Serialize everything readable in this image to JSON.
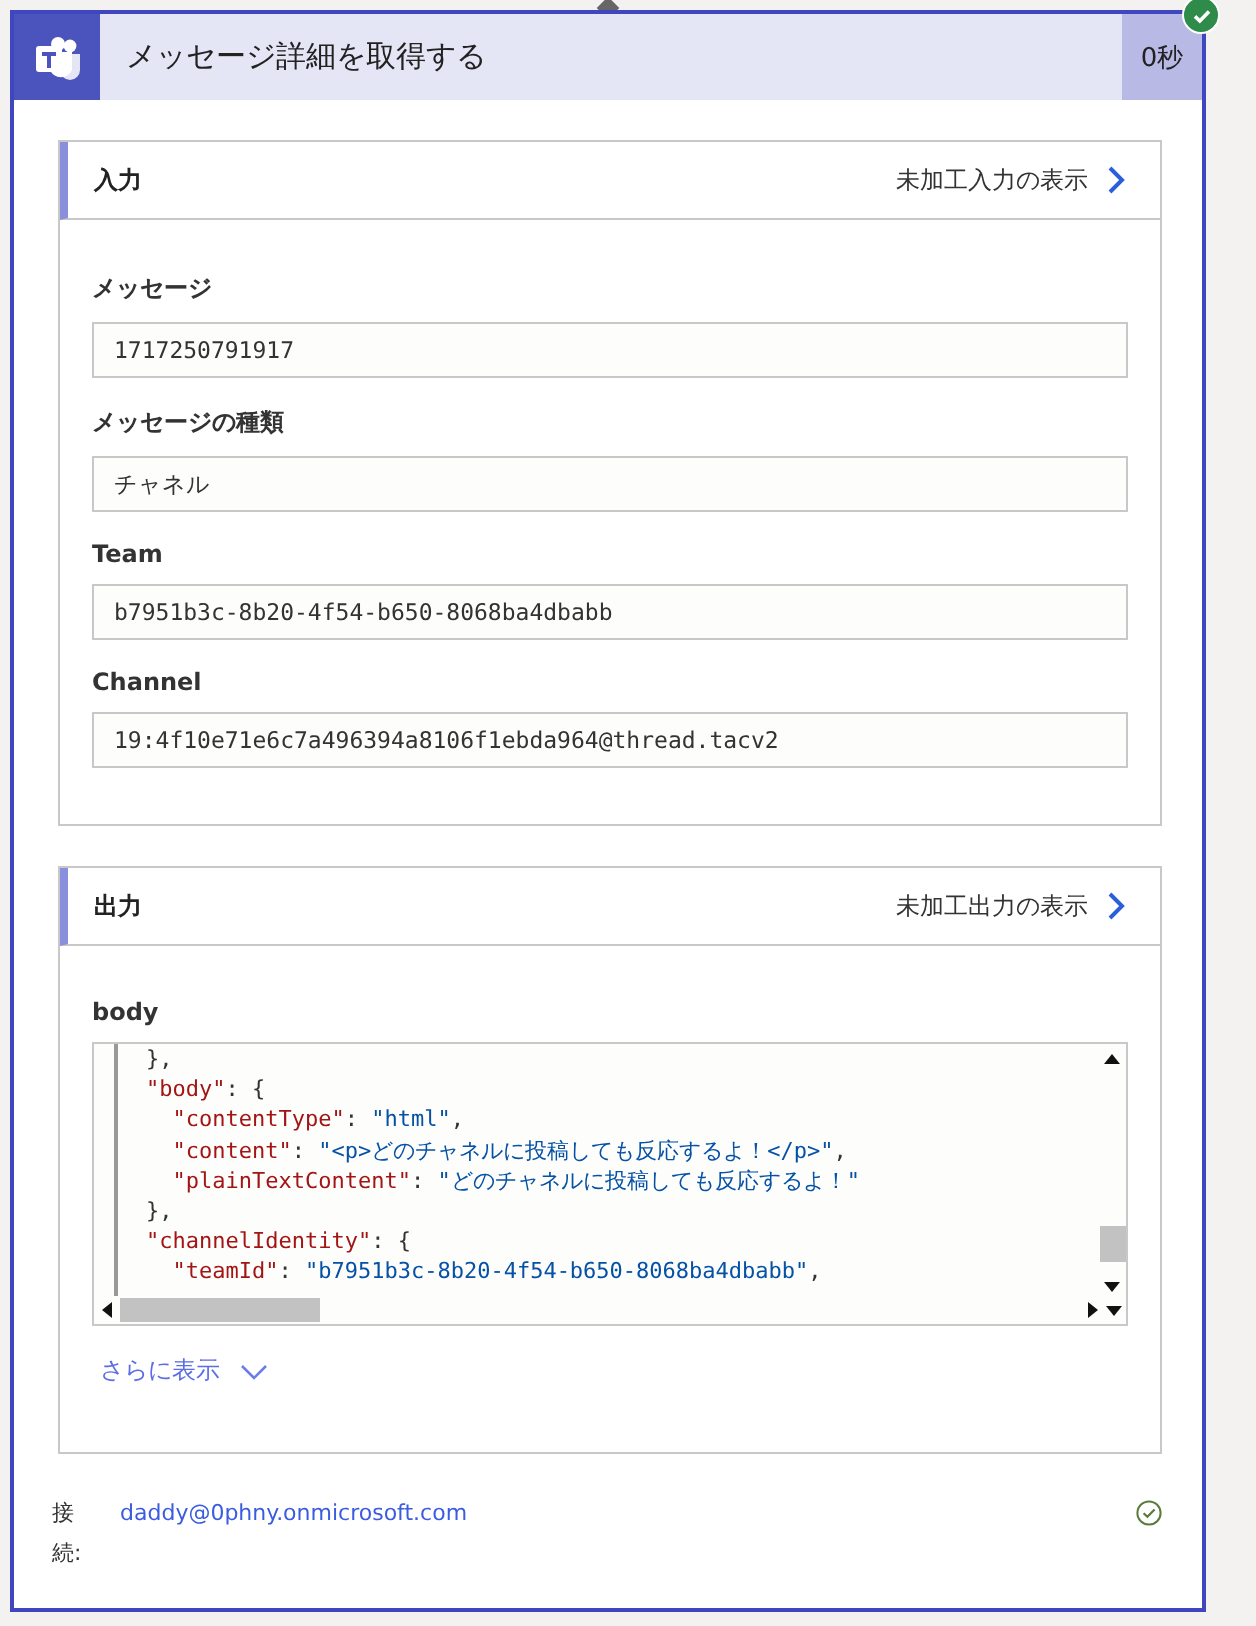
{
  "action": {
    "title": "メッセージ詳細を取得する",
    "duration": "0秒",
    "succeeded": true
  },
  "inputs": {
    "title": "入力",
    "raw_link": "未加工入力の表示",
    "fields": [
      {
        "label": "メッセージ",
        "value": "1717250791917"
      },
      {
        "label": "メッセージの種類",
        "value": "チャネル"
      },
      {
        "label": "Team",
        "value": "b7951b3c-8b20-4f54-b650-8068ba4dbabb"
      },
      {
        "label": "Channel",
        "value": "19:4f10e71e6c7a496394a8106f1ebda964@thread.tacv2"
      }
    ]
  },
  "outputs": {
    "title": "出力",
    "raw_link": "未加工出力の表示",
    "field_label": "body",
    "code_lines": [
      [
        {
          "kind": "punct",
          "text": "},"
        }
      ],
      [
        {
          "kind": "key",
          "text": "\"body\""
        },
        {
          "kind": "punct",
          "text": ": {"
        }
      ],
      [
        {
          "kind": "key",
          "text": "  \"contentType\""
        },
        {
          "kind": "punct",
          "text": ": "
        },
        {
          "kind": "string",
          "text": "\"html\""
        },
        {
          "kind": "punct",
          "text": ","
        }
      ],
      [
        {
          "kind": "key",
          "text": "  \"content\""
        },
        {
          "kind": "punct",
          "text": ": "
        },
        {
          "kind": "string",
          "text": "\"<p>どのチャネルに投稿しても反応するよ！</p>\""
        },
        {
          "kind": "punct",
          "text": ","
        }
      ],
      [
        {
          "kind": "key",
          "text": "  \"plainTextContent\""
        },
        {
          "kind": "punct",
          "text": ": "
        },
        {
          "kind": "string",
          "text": "\"どのチャネルに投稿しても反応するよ！\""
        }
      ],
      [
        {
          "kind": "punct",
          "text": "},"
        }
      ],
      [
        {
          "kind": "key",
          "text": "\"channelIdentity\""
        },
        {
          "kind": "punct",
          "text": ": {"
        }
      ],
      [
        {
          "kind": "key",
          "text": "  \"teamId\""
        },
        {
          "kind": "punct",
          "text": ": "
        },
        {
          "kind": "string",
          "text": "\"b7951b3c-8b20-4f54-b650-8068ba4dbabb\""
        },
        {
          "kind": "punct",
          "text": ","
        }
      ]
    ],
    "show_more": "さらに表示"
  },
  "connection": {
    "label": "接続:",
    "account": "daddy@0phny.onmicrosoft.com",
    "ok": true
  }
}
